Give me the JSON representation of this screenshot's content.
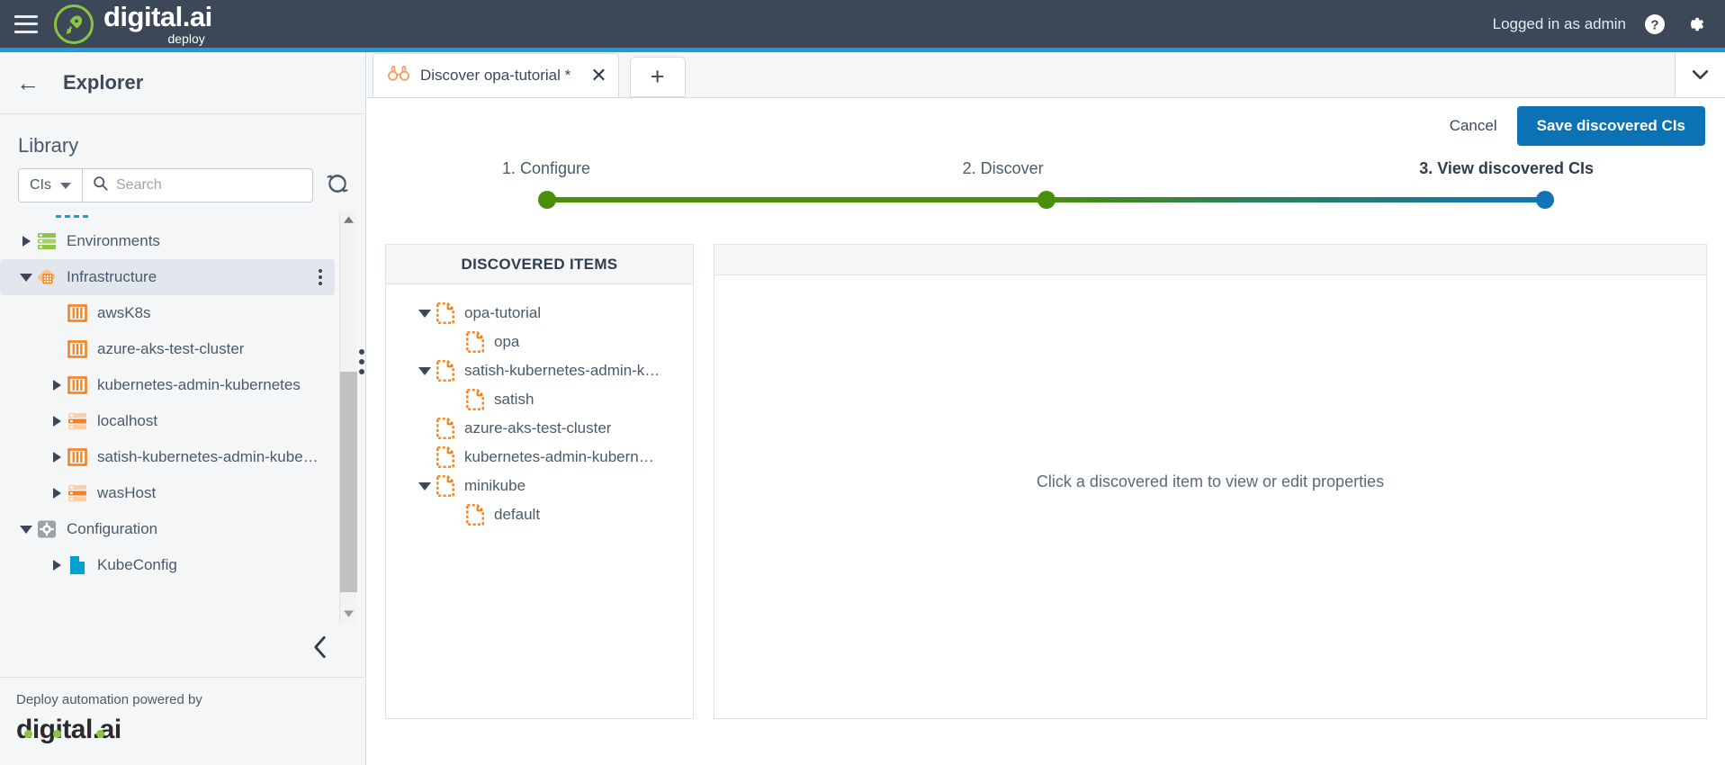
{
  "header": {
    "menu_icon": "hamburger-icon",
    "logo_main": "digital.ai",
    "logo_sub": "deploy",
    "rocket_icon": "rocket-icon",
    "user_status": "Logged in as admin",
    "help_icon": "help-icon",
    "settings_icon": "gear-icon",
    "accent_blue": "#1e9bde",
    "bar_color": "#3c4858",
    "brand_green": "#8bc53f"
  },
  "sidebar": {
    "back_icon": "back-arrow-icon",
    "title": "Explorer",
    "section_title": "Library",
    "filter": {
      "label": "CIs",
      "caret_icon": "chevron-down-icon"
    },
    "search": {
      "placeholder": "Search",
      "value": "",
      "icon": "search-icon"
    },
    "refresh_icon": "refresh-icon",
    "tree": [
      {
        "label": "Environments",
        "indent": 0,
        "twisty": "right",
        "icon": "environments-icon",
        "selected": false,
        "kebab": false
      },
      {
        "label": "Infrastructure",
        "indent": 0,
        "twisty": "down",
        "icon": "infrastructure-icon",
        "selected": true,
        "kebab": true
      },
      {
        "label": "awsK8s",
        "indent": 1,
        "twisty": "none",
        "icon": "k8s-cluster-icon",
        "selected": false,
        "kebab": false
      },
      {
        "label": "azure-aks-test-cluster",
        "indent": 1,
        "twisty": "none",
        "icon": "k8s-cluster-icon",
        "selected": false,
        "kebab": false
      },
      {
        "label": "kubernetes-admin-kubernetes",
        "indent": 1,
        "twisty": "right",
        "icon": "k8s-cluster-icon",
        "selected": false,
        "kebab": false
      },
      {
        "label": "localhost",
        "indent": 1,
        "twisty": "right",
        "icon": "host-icon",
        "selected": false,
        "kebab": false
      },
      {
        "label": "satish-kubernetes-admin-kube…",
        "indent": 1,
        "twisty": "right",
        "icon": "k8s-cluster-icon",
        "selected": false,
        "kebab": false
      },
      {
        "label": "wasHost",
        "indent": 1,
        "twisty": "right",
        "icon": "host-icon",
        "selected": false,
        "kebab": false
      },
      {
        "label": "Configuration",
        "indent": 0,
        "twisty": "down",
        "icon": "configuration-icon",
        "selected": false,
        "kebab": false
      },
      {
        "label": "KubeConfig",
        "indent": 1,
        "twisty": "right",
        "icon": "file-blue-icon",
        "selected": false,
        "kebab": false
      }
    ],
    "scroll_up_icon": "scroll-up-arrow-icon",
    "scroll_down_icon": "scroll-down-arrow-icon",
    "collapse_icon": "chevron-left-icon",
    "footer_text": "Deploy automation powered by",
    "footer_logo": "digital.ai"
  },
  "tabs": {
    "items": [
      {
        "label": "Discover opa-tutorial *",
        "icon": "binoculars-icon",
        "active": true,
        "close_icon": "close-icon"
      }
    ],
    "add_label": "+",
    "overflow_icon": "chevron-down-icon"
  },
  "actions": {
    "cancel_label": "Cancel",
    "save_label": "Save discovered CIs",
    "primary_color": "#0b72b5"
  },
  "stepper": {
    "steps": [
      {
        "label": "1. Configure",
        "state": "done",
        "color": "#4a8f0a"
      },
      {
        "label": "2. Discover",
        "state": "done",
        "color": "#4a8f0a"
      },
      {
        "label": "3. View discovered CIs",
        "state": "current",
        "color": "#1175b5"
      }
    ]
  },
  "discovered": {
    "panel_title": "DISCOVERED ITEMS",
    "items": [
      {
        "label": "opa-tutorial",
        "indent": 0,
        "twisty": "down",
        "icon": "ci-document-icon"
      },
      {
        "label": "opa",
        "indent": 1,
        "twisty": "none",
        "icon": "ci-document-icon"
      },
      {
        "label": "satish-kubernetes-admin-k…",
        "indent": 0,
        "twisty": "down",
        "icon": "ci-document-icon"
      },
      {
        "label": "satish",
        "indent": 1,
        "twisty": "none",
        "icon": "ci-document-icon"
      },
      {
        "label": "azure-aks-test-cluster",
        "indent": 0,
        "twisty": "none",
        "icon": "ci-document-icon"
      },
      {
        "label": "kubernetes-admin-kubern…",
        "indent": 0,
        "twisty": "none",
        "icon": "ci-document-icon"
      },
      {
        "label": "minikube",
        "indent": 0,
        "twisty": "down",
        "icon": "ci-document-icon"
      },
      {
        "label": "default",
        "indent": 1,
        "twisty": "none",
        "icon": "ci-document-icon"
      }
    ],
    "icon_color": "#f5821f"
  },
  "properties": {
    "empty_message": "Click a discovered item to view or edit properties"
  }
}
